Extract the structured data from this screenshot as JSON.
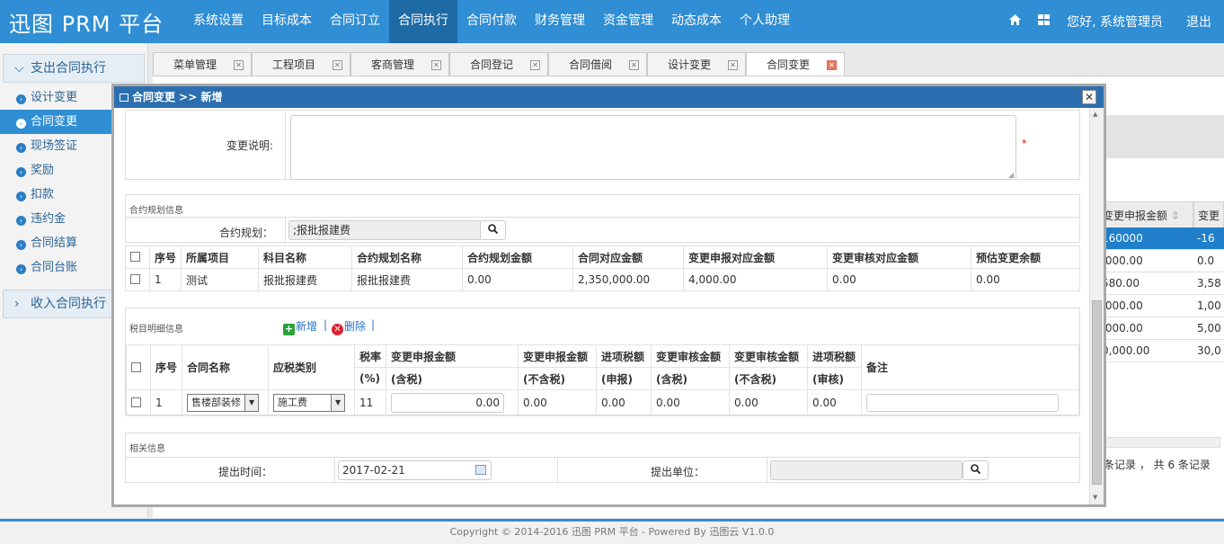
{
  "app": {
    "brand": "迅图 PRM 平台"
  },
  "topnav": {
    "items": [
      "系统设置",
      "目标成本",
      "合同订立",
      "合同执行",
      "合同付款",
      "财务管理",
      "资金管理",
      "动态成本",
      "个人助理"
    ],
    "active": "合同执行",
    "greeting": "您好, 系统管理员",
    "logout": "退出",
    "icons": [
      "home-icon",
      "grid-icon"
    ]
  },
  "sidebar": {
    "section1": "支出合同执行",
    "items": [
      "设计变更",
      "合同变更",
      "现场签证",
      "奖励",
      "扣款",
      "违约金",
      "合同结算",
      "合同台账"
    ],
    "active": "合同变更",
    "section2": "收入合同执行"
  },
  "tabs": [
    "菜单管理",
    "工程项目",
    "客商管理",
    "合同登记",
    "合同借阅",
    "设计变更",
    "合同变更"
  ],
  "active_tab": "合同变更",
  "background": {
    "col1_header": "变更申报金额",
    "col2_header": "变更",
    "rows_col1": [
      "160000",
      ",000.00",
      "580.00",
      ",000.00",
      ",000.00",
      "0,000.00"
    ],
    "rows_col2": [
      "-16",
      "0.0",
      "3,58",
      "1,00",
      "5,00",
      "30,0"
    ],
    "pager": "条记录 ， 共 6 条记录"
  },
  "modal": {
    "title": "合同变更 >> 新增",
    "change_desc_label": "变更说明:",
    "required_mark": "*",
    "plan_section": "合约规划信息",
    "plan_label": "合约规划：",
    "plan_value": ";报批报建费",
    "plan_table": {
      "headers": [
        "序号",
        "所属项目",
        "科目名称",
        "合约规划名称",
        "合约规划金额",
        "合同对应金额",
        "变更申报对应金额",
        "变更审核对应金额",
        "预估变更余额"
      ],
      "rows": [
        [
          "1",
          "测试",
          "报批报建费",
          "报批报建费",
          "0.00",
          "2,350,000.00",
          "4,000.00",
          "0.00",
          "0.00"
        ]
      ]
    },
    "tax_section": "税目明细信息",
    "add_label": "新增",
    "delete_label": "删除",
    "tax_table": {
      "h_seq": "序号",
      "h_contract": "合同名称",
      "h_taxtype": "应税类别",
      "h_rate1": "税率",
      "h_rate2": "(%)",
      "h_c1a": "变更申报金额",
      "h_c1b": "(含税)",
      "h_c2a": "变更申报金额",
      "h_c2b": "(不含税)",
      "h_c3a": "进项税额",
      "h_c3b": "(申报)",
      "h_c4a": "变更审核金额",
      "h_c4b": "(含税)",
      "h_c5a": "变更审核金额",
      "h_c5b": "(不含税)",
      "h_c6a": "进项税额",
      "h_c6b": "(审核)",
      "h_remark": "备注",
      "row": {
        "seq": "1",
        "contract": "售楼部装修",
        "taxtype": "施工费",
        "rate": "11",
        "declare_incl": "0.00",
        "declare_excl": "0.00",
        "input_tax_decl": "0.00",
        "audit_incl": "0.00",
        "audit_excl": "0.00",
        "input_tax_audit": "0.00",
        "remark": ""
      }
    },
    "related_section": "相关信息",
    "submit_time_label": "提出时间：",
    "submit_time_value": "2017-02-21",
    "submit_unit_label": "提出单位：",
    "submit_unit_value": ""
  },
  "footer": "Copyright © 2014-2016 迅图 PRM 平台 - Powered By 迅图云 V1.0.0"
}
